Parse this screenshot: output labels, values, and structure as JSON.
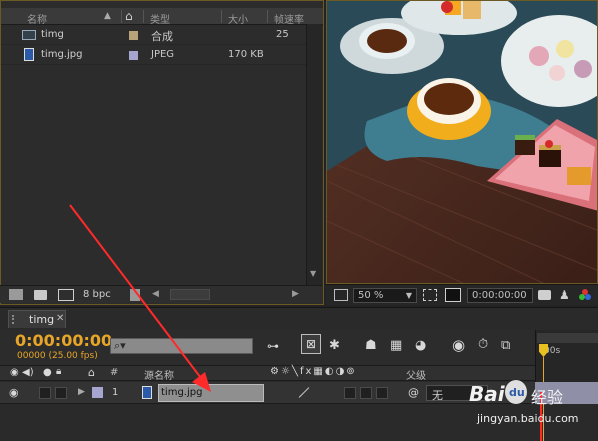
{
  "project": {
    "columns": {
      "name": "名称",
      "type": "类型",
      "size": "大小",
      "fps": "帧速率"
    },
    "items": [
      {
        "name": "timg",
        "type": "合成",
        "size": "",
        "fps": "25",
        "label_color": "#b7a27a"
      },
      {
        "name": "timg.jpg",
        "type": "JPEG",
        "size": "170 KB",
        "fps": "",
        "label_color": "#a5a5cf"
      }
    ],
    "footer": {
      "bpc": "8 bpc"
    }
  },
  "viewer": {
    "zoom": "50 %",
    "timecode": "0:00:00:00"
  },
  "timeline": {
    "tab_title": "timg",
    "current_time": "0:00:00:00",
    "frame_info": "00000 (25.00 fps)",
    "search_placeholder": "",
    "columns": {
      "number": "#",
      "source_name": "源名称",
      "parent": "父级"
    },
    "ruler_start": "00s",
    "layers": [
      {
        "number": "1",
        "source_name": "timg.jpg",
        "parent": "无",
        "label_color": "#a5a5cf"
      }
    ]
  },
  "watermark": {
    "brand": "Bai",
    "paw": "du",
    "suffix": "经验",
    "url": "jingyan.baidu.com"
  },
  "colors": {
    "timecode": "#e8a628",
    "panel_border": "#6b5a23",
    "annotation": "#ff2a2a",
    "track": "#8f8fa8"
  }
}
